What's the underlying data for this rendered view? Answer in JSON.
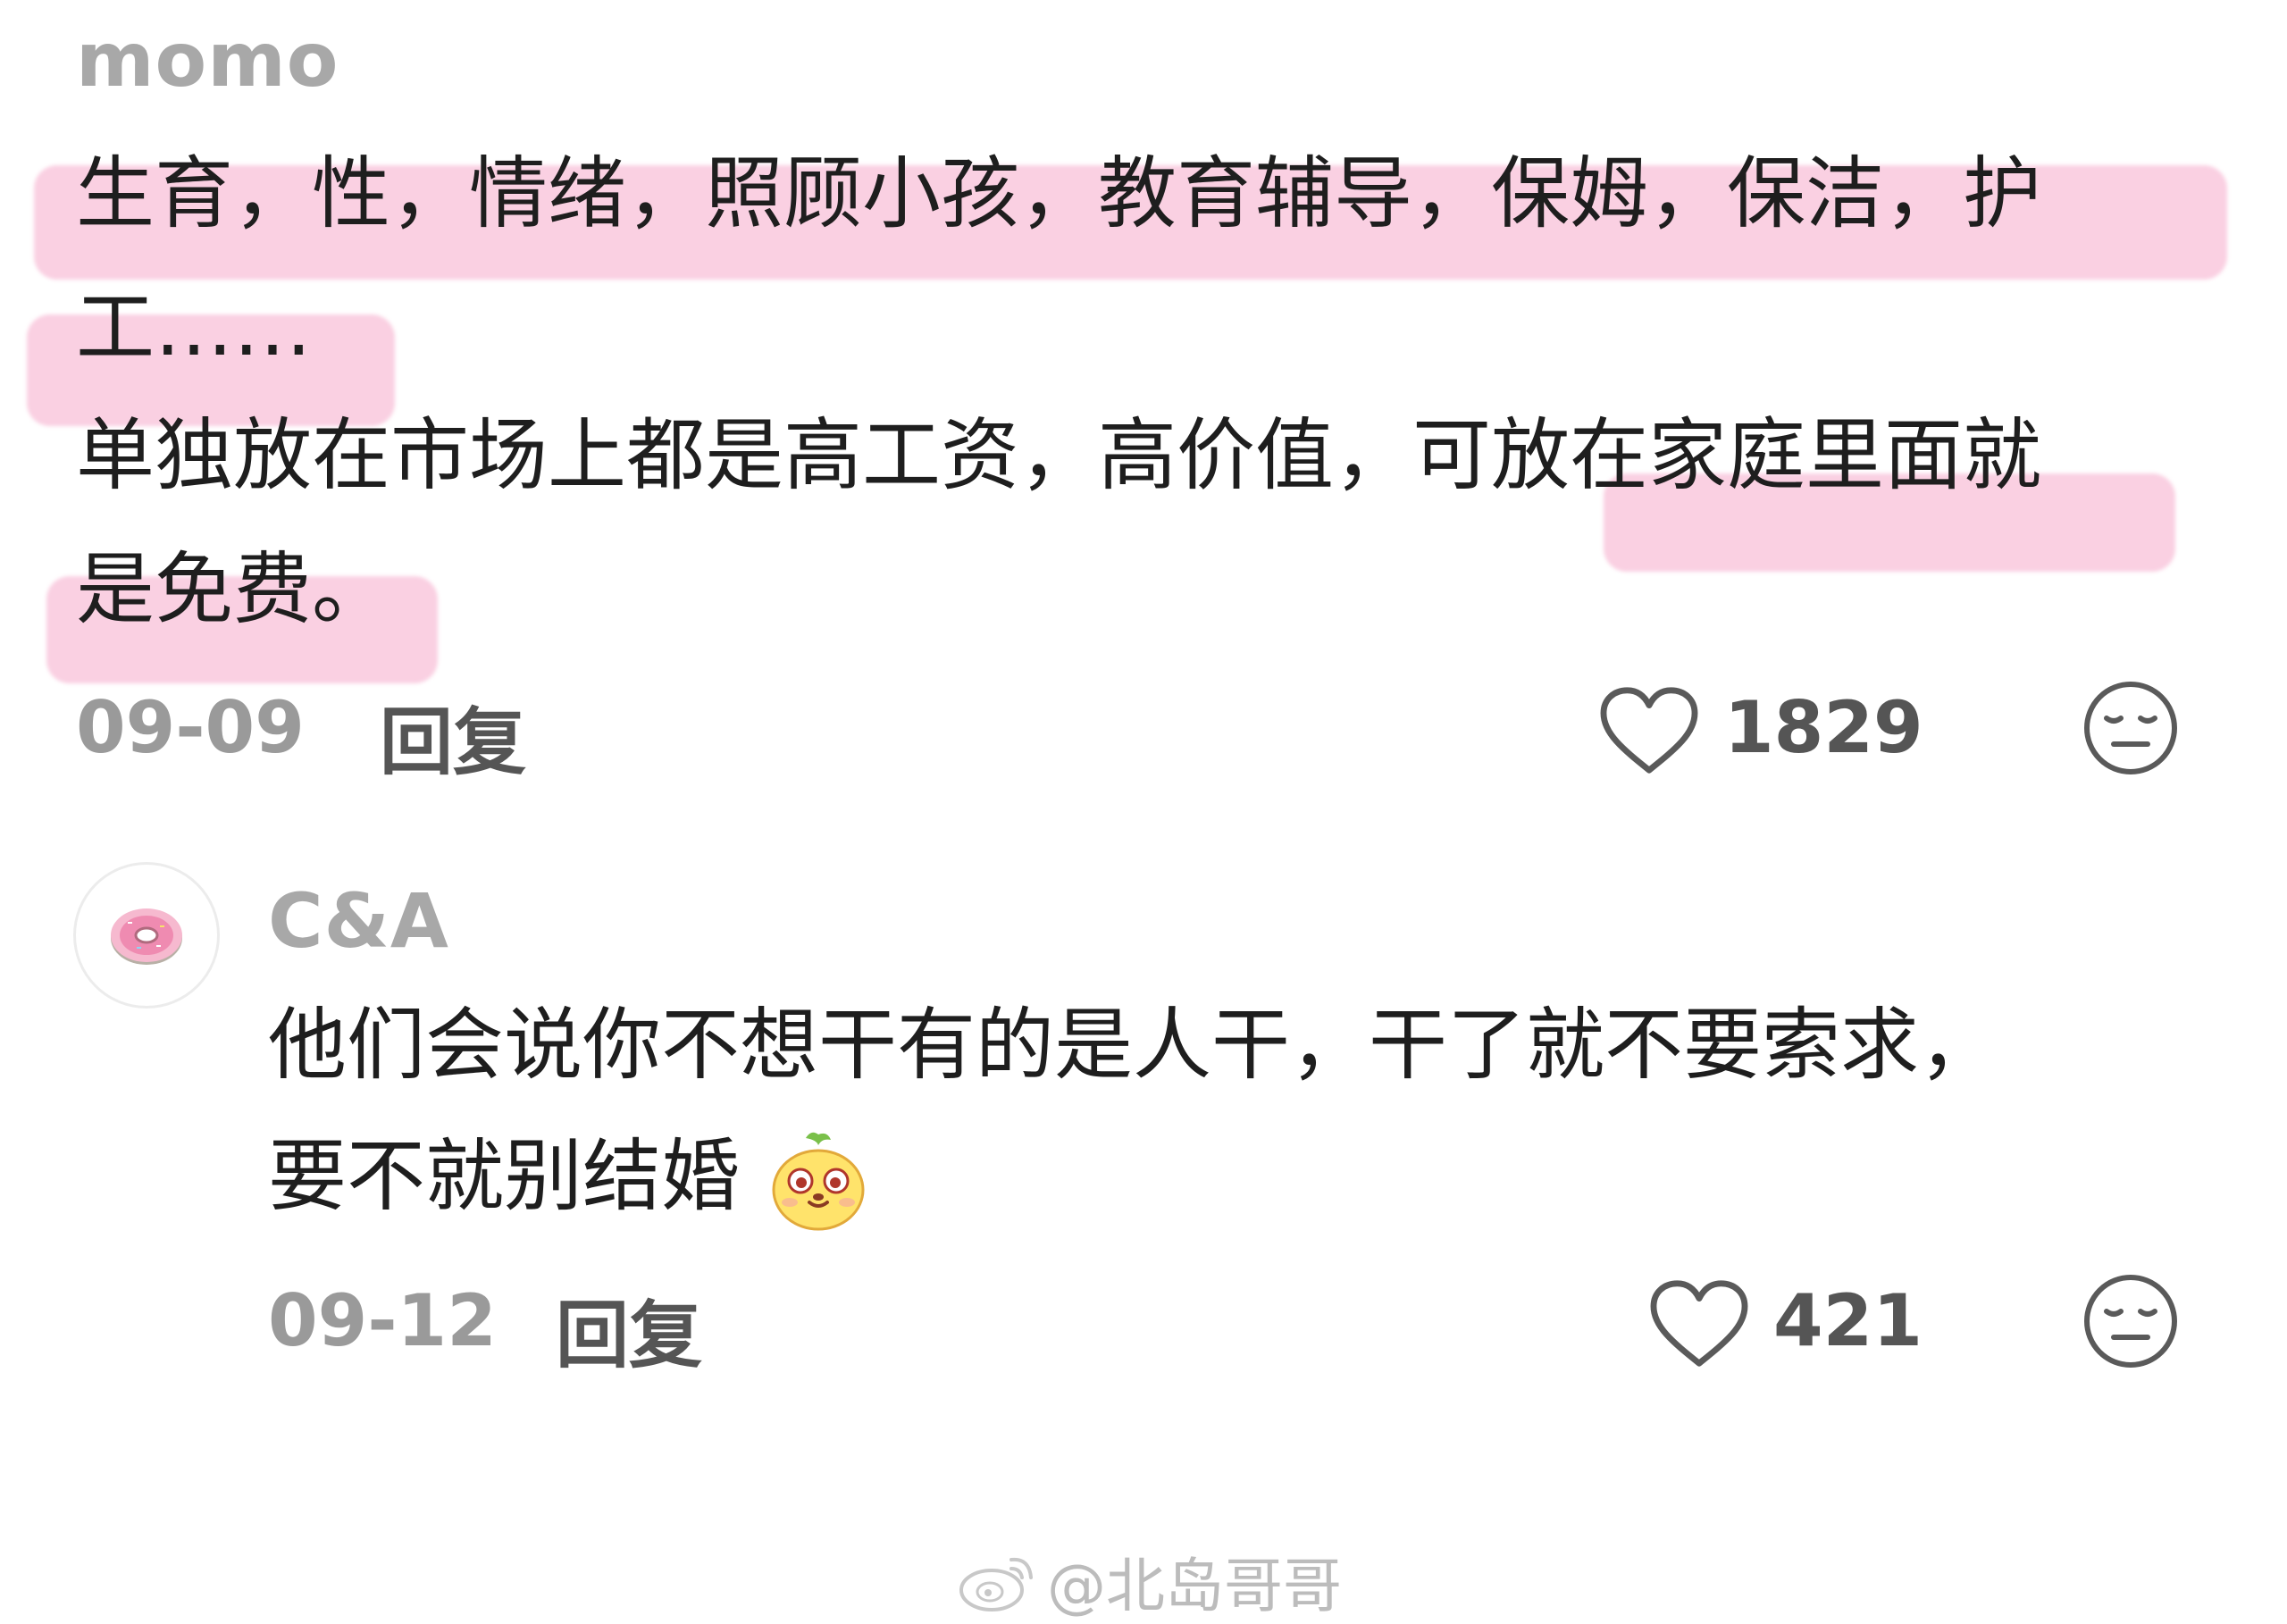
{
  "comments": [
    {
      "username": "momo",
      "lines": [
        "生育，性，情绪，照顾小孩，教育辅导，保姆，保洁，护",
        "工……",
        "单独放在市场上都是高工资，高价值，可放在家庭里面就",
        "是免费。"
      ],
      "date": "09-09",
      "reply_label": "回复",
      "like_count": "1829"
    },
    {
      "username": "C&A",
      "lines": [
        "他们会说你不想干有的是人干，干了就不要索求，",
        "要不就别结婚"
      ],
      "date": "09-12",
      "reply_label": "回复",
      "like_count": "421"
    }
  ],
  "watermark": {
    "text": "@北岛哥哥"
  },
  "icons": {
    "like": "heart-outline-icon",
    "dislike": "neutral-face-icon",
    "avatar": "donut-avatar",
    "emoji": "yellow-dog-emoji",
    "watermark": "weibo-logo-icon"
  },
  "colors": {
    "highlight": "#f596be",
    "meta_gray": "#9a9a9a",
    "username_gray": "#a8a8a8"
  }
}
